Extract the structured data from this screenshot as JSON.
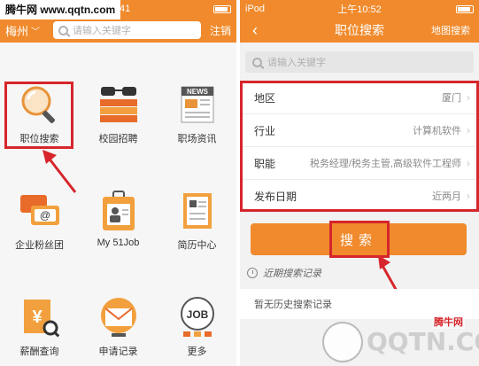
{
  "watermark": {
    "site": "腾牛网 www.qqtn.com",
    "logo_text": "QQTN.COM",
    "logo_badge": "腾牛网"
  },
  "left": {
    "status": {
      "time": "10:41"
    },
    "nav": {
      "city": "梅州",
      "search_placeholder": "请输入关键字",
      "logout_label": "注销"
    },
    "menu": [
      {
        "label": "职位搜索",
        "icon": "magnifier-icon"
      },
      {
        "label": "校园招聘",
        "icon": "glasses-books-icon"
      },
      {
        "label": "职场资讯",
        "icon": "news-icon"
      },
      {
        "label": "企业粉丝团",
        "icon": "chat-bubbles-icon"
      },
      {
        "label": "My 51Job",
        "icon": "id-badge-icon"
      },
      {
        "label": "简历中心",
        "icon": "resume-icon"
      },
      {
        "label": "薪酬查询",
        "icon": "yen-search-icon"
      },
      {
        "label": "申请记录",
        "icon": "envelope-icon"
      },
      {
        "label": "更多",
        "icon": "job-more-icon"
      }
    ],
    "icon_text": {
      "news": "NEWS",
      "job": "JOB",
      "mail_at": "@",
      "yen": "¥"
    }
  },
  "right": {
    "status": {
      "carrier": "iPod",
      "time": "上午10:52"
    },
    "nav": {
      "back": "‹",
      "title": "职位搜索",
      "map_label": "地图搜索"
    },
    "search_placeholder": "请输入关键字",
    "filters": [
      {
        "key": "地区",
        "value": "厦门"
      },
      {
        "key": "行业",
        "value": "计算机软件"
      },
      {
        "key": "职能",
        "value": "税务经理/税务主管,高级软件工程师"
      },
      {
        "key": "发布日期",
        "value": "近两月"
      }
    ],
    "search_button": "搜索",
    "recent_label": "近期搜索记录",
    "no_history": "暂无历史搜索记录"
  },
  "colors": {
    "brand_orange": "#f08a2c",
    "highlight_red": "#d6262c"
  }
}
